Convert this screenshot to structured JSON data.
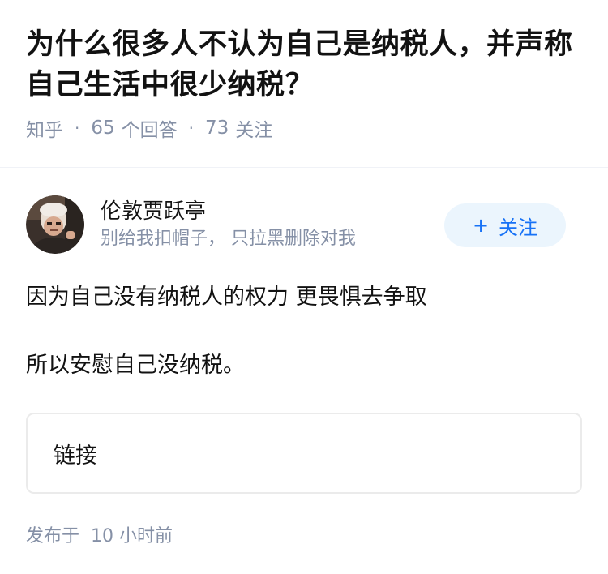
{
  "question": {
    "title": "为什么很多人不认为自己是纳税人，并声称自己生活中很少纳税？",
    "source": "知乎",
    "answer_count": "65",
    "answer_label": "个回答",
    "follow_count": "73",
    "follow_label": "关注"
  },
  "author": {
    "name": "伦敦贾跃亭",
    "bio": "别给我扣帽子， 只拉黑删除对我",
    "avatar_icon": "person-photo",
    "follow_button": "关注",
    "follow_icon": "plus-icon"
  },
  "answer": {
    "paragraphs": [
      "因为自己没有纳税人的权力 更畏惧去争取",
      "所以安慰自己没纳税。"
    ],
    "link_card_label": "链接",
    "published_prefix": "发布于",
    "published_time": "10 小时前"
  },
  "colors": {
    "meta_gray": "#8590a6",
    "accent_blue": "#1772f6",
    "button_bg": "#ebf5fd"
  }
}
